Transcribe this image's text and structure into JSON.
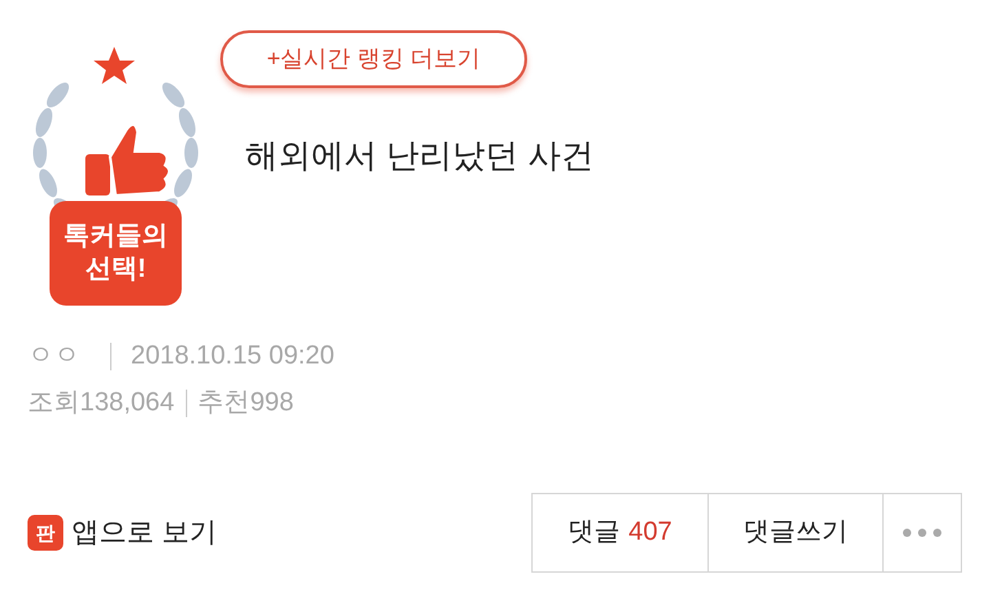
{
  "badge": {
    "lines": [
      "톡커들의",
      "선택!"
    ]
  },
  "ranking_link": "+실시간 랭킹 더보기",
  "title": "해외에서 난리났던 사건",
  "meta": {
    "author": "ㅇㅇ",
    "date": "2018.10.15 09:20",
    "views_label": "조회",
    "views": "138,064",
    "likes_label": "추천",
    "likes": "998"
  },
  "app_link": {
    "icon_text": "판",
    "label": "앱으로 보기"
  },
  "actions": {
    "comments_label": "댓글",
    "comments_count": "407",
    "write_label": "댓글쓰기"
  }
}
